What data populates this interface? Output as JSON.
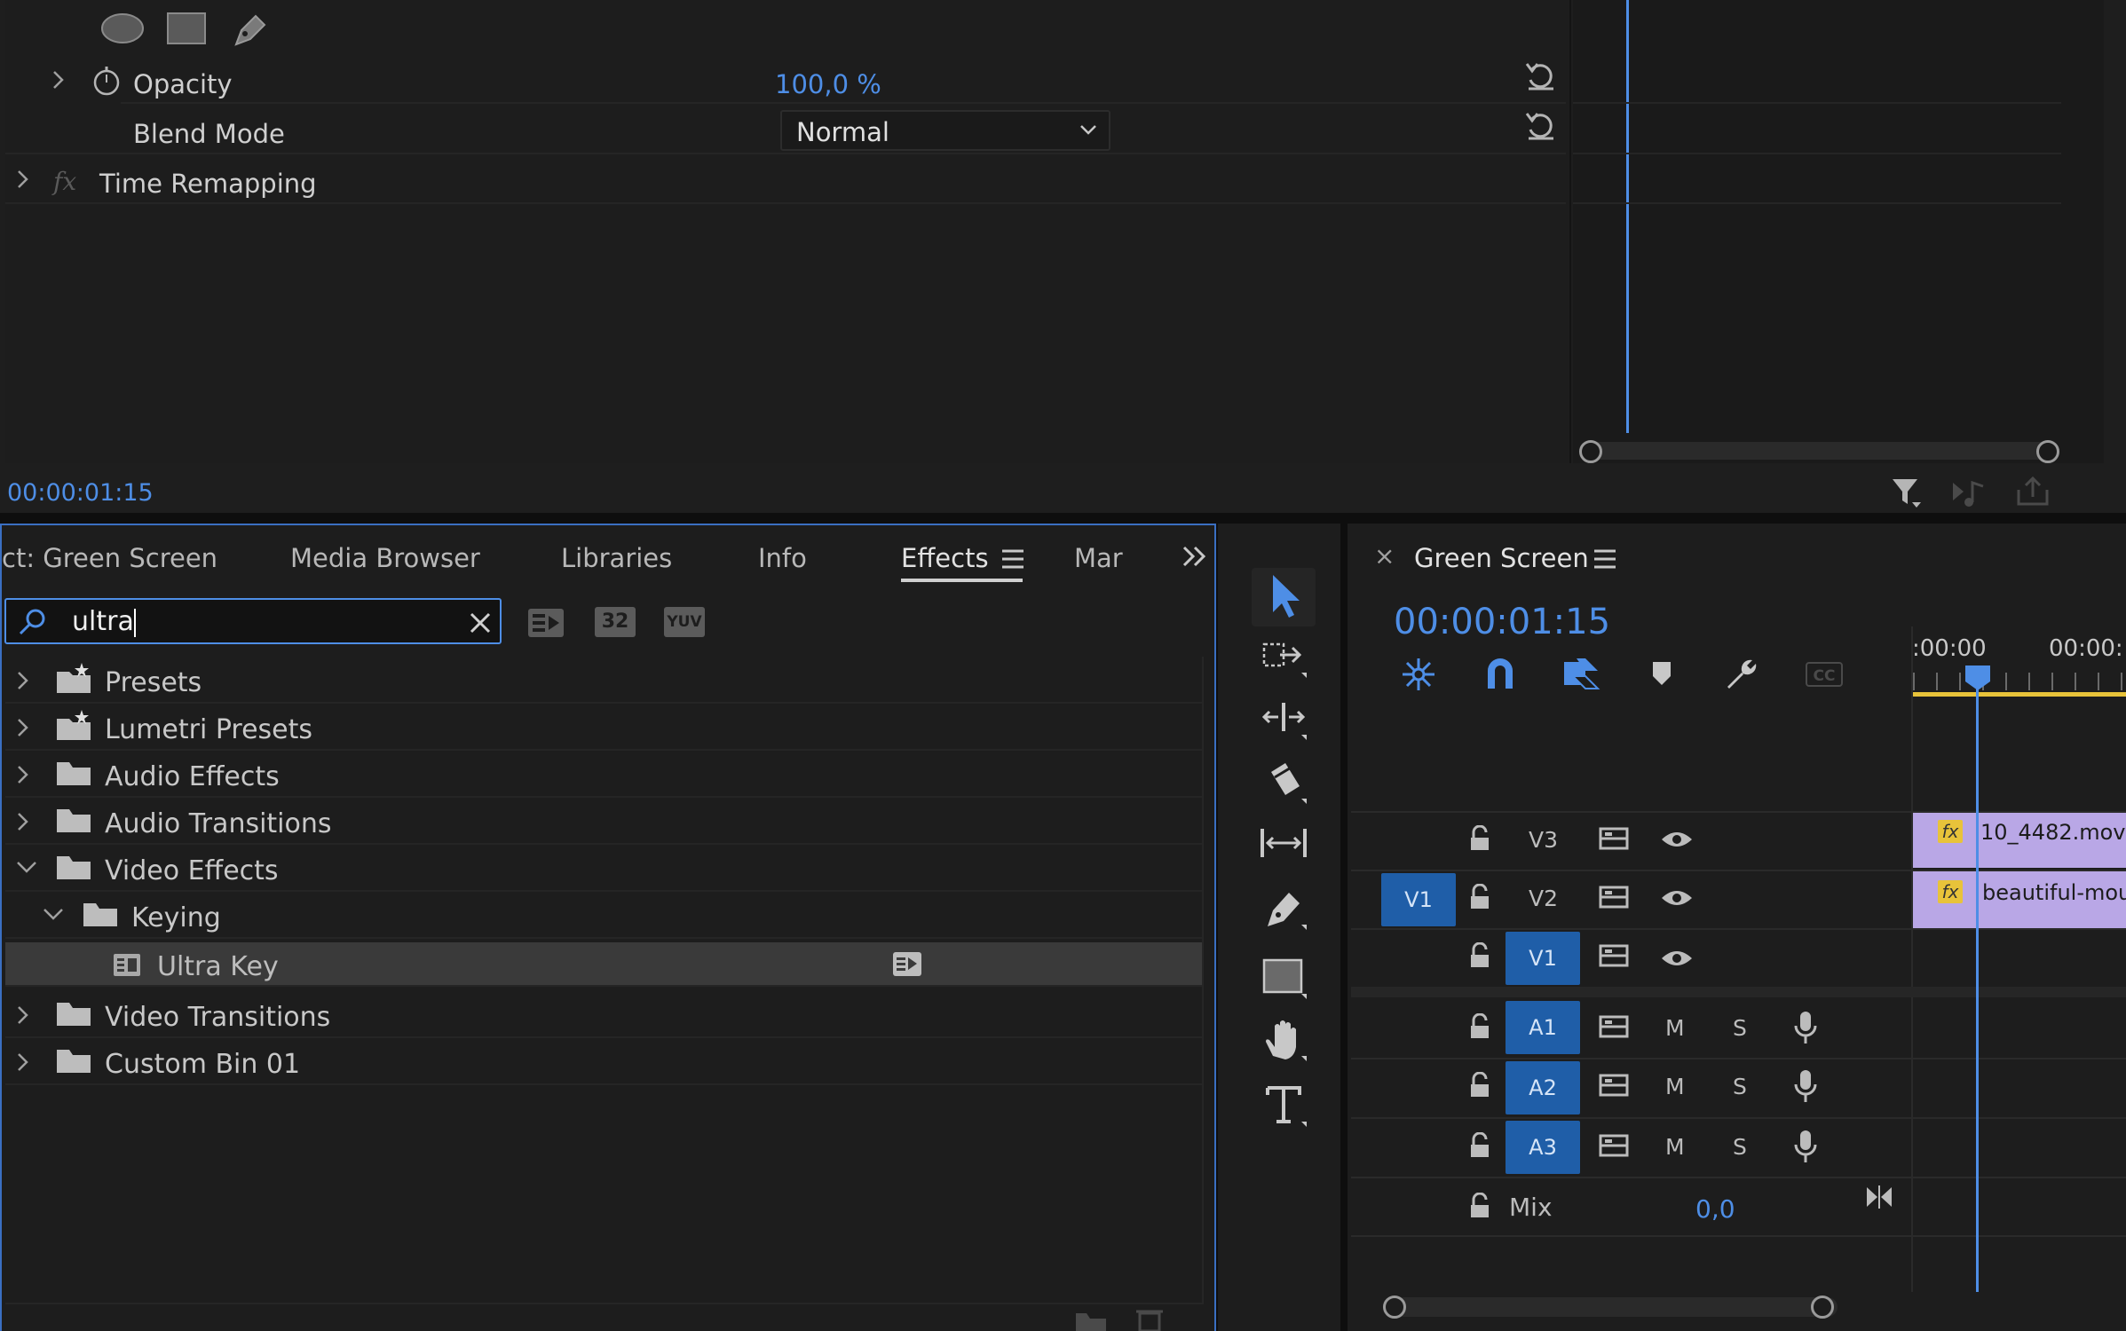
{
  "effect_controls": {
    "opacity_label": "Opacity",
    "opacity_value": "100,0 %",
    "blend_mode_label": "Blend Mode",
    "blend_mode_value": "Normal",
    "time_remapping_label": "Time Remapping",
    "fx_label": "fx",
    "timecode": "00:00:01:15"
  },
  "effects_panel": {
    "tabs": [
      "ct: Green Screen",
      "Media Browser",
      "Libraries",
      "Info",
      "Effects",
      "Mar"
    ],
    "active_tab": "Effects",
    "search_value": "ultra",
    "filter_buttons": [
      "32",
      "YUV"
    ],
    "tree": [
      {
        "label": "Presets",
        "expanded": false
      },
      {
        "label": "Lumetri Presets",
        "expanded": false
      },
      {
        "label": "Audio Effects",
        "expanded": false
      },
      {
        "label": "Audio Transitions",
        "expanded": false
      },
      {
        "label": "Video Effects",
        "expanded": true
      },
      {
        "label": "Keying",
        "expanded": true
      },
      {
        "label": "Ultra Key",
        "selected": true
      },
      {
        "label": "Video Transitions",
        "expanded": false
      },
      {
        "label": "Custom Bin 01",
        "expanded": false
      }
    ]
  },
  "timeline": {
    "close": "×",
    "sequence_name": "Green Screen",
    "timecode": "00:00:01:15",
    "ruler_labels": [
      ":00:00",
      "00:00:"
    ],
    "video_tracks": [
      {
        "name": "V3",
        "source": ""
      },
      {
        "name": "V2",
        "source": "V1"
      },
      {
        "name": "V1",
        "source": ""
      }
    ],
    "audio_tracks": [
      {
        "name": "A1",
        "m": "M",
        "s": "S"
      },
      {
        "name": "A2",
        "m": "M",
        "s": "S"
      },
      {
        "name": "A3",
        "m": "M",
        "s": "S"
      }
    ],
    "mix_label": "Mix",
    "mix_value": "0,0",
    "clips": [
      {
        "track": "V3",
        "name": "10_4482.mov",
        "fx": "fx"
      },
      {
        "track": "V2",
        "name": "beautiful-moun",
        "fx": "fx"
      }
    ],
    "cc_label": "CC"
  },
  "colors": {
    "accent_blue": "#4e8ee6",
    "track_blue": "#1f5ea8",
    "clip_purple": "#b9a7e6",
    "fx_yellow": "#e8c33a",
    "work_area_yellow": "#e8c33a"
  }
}
